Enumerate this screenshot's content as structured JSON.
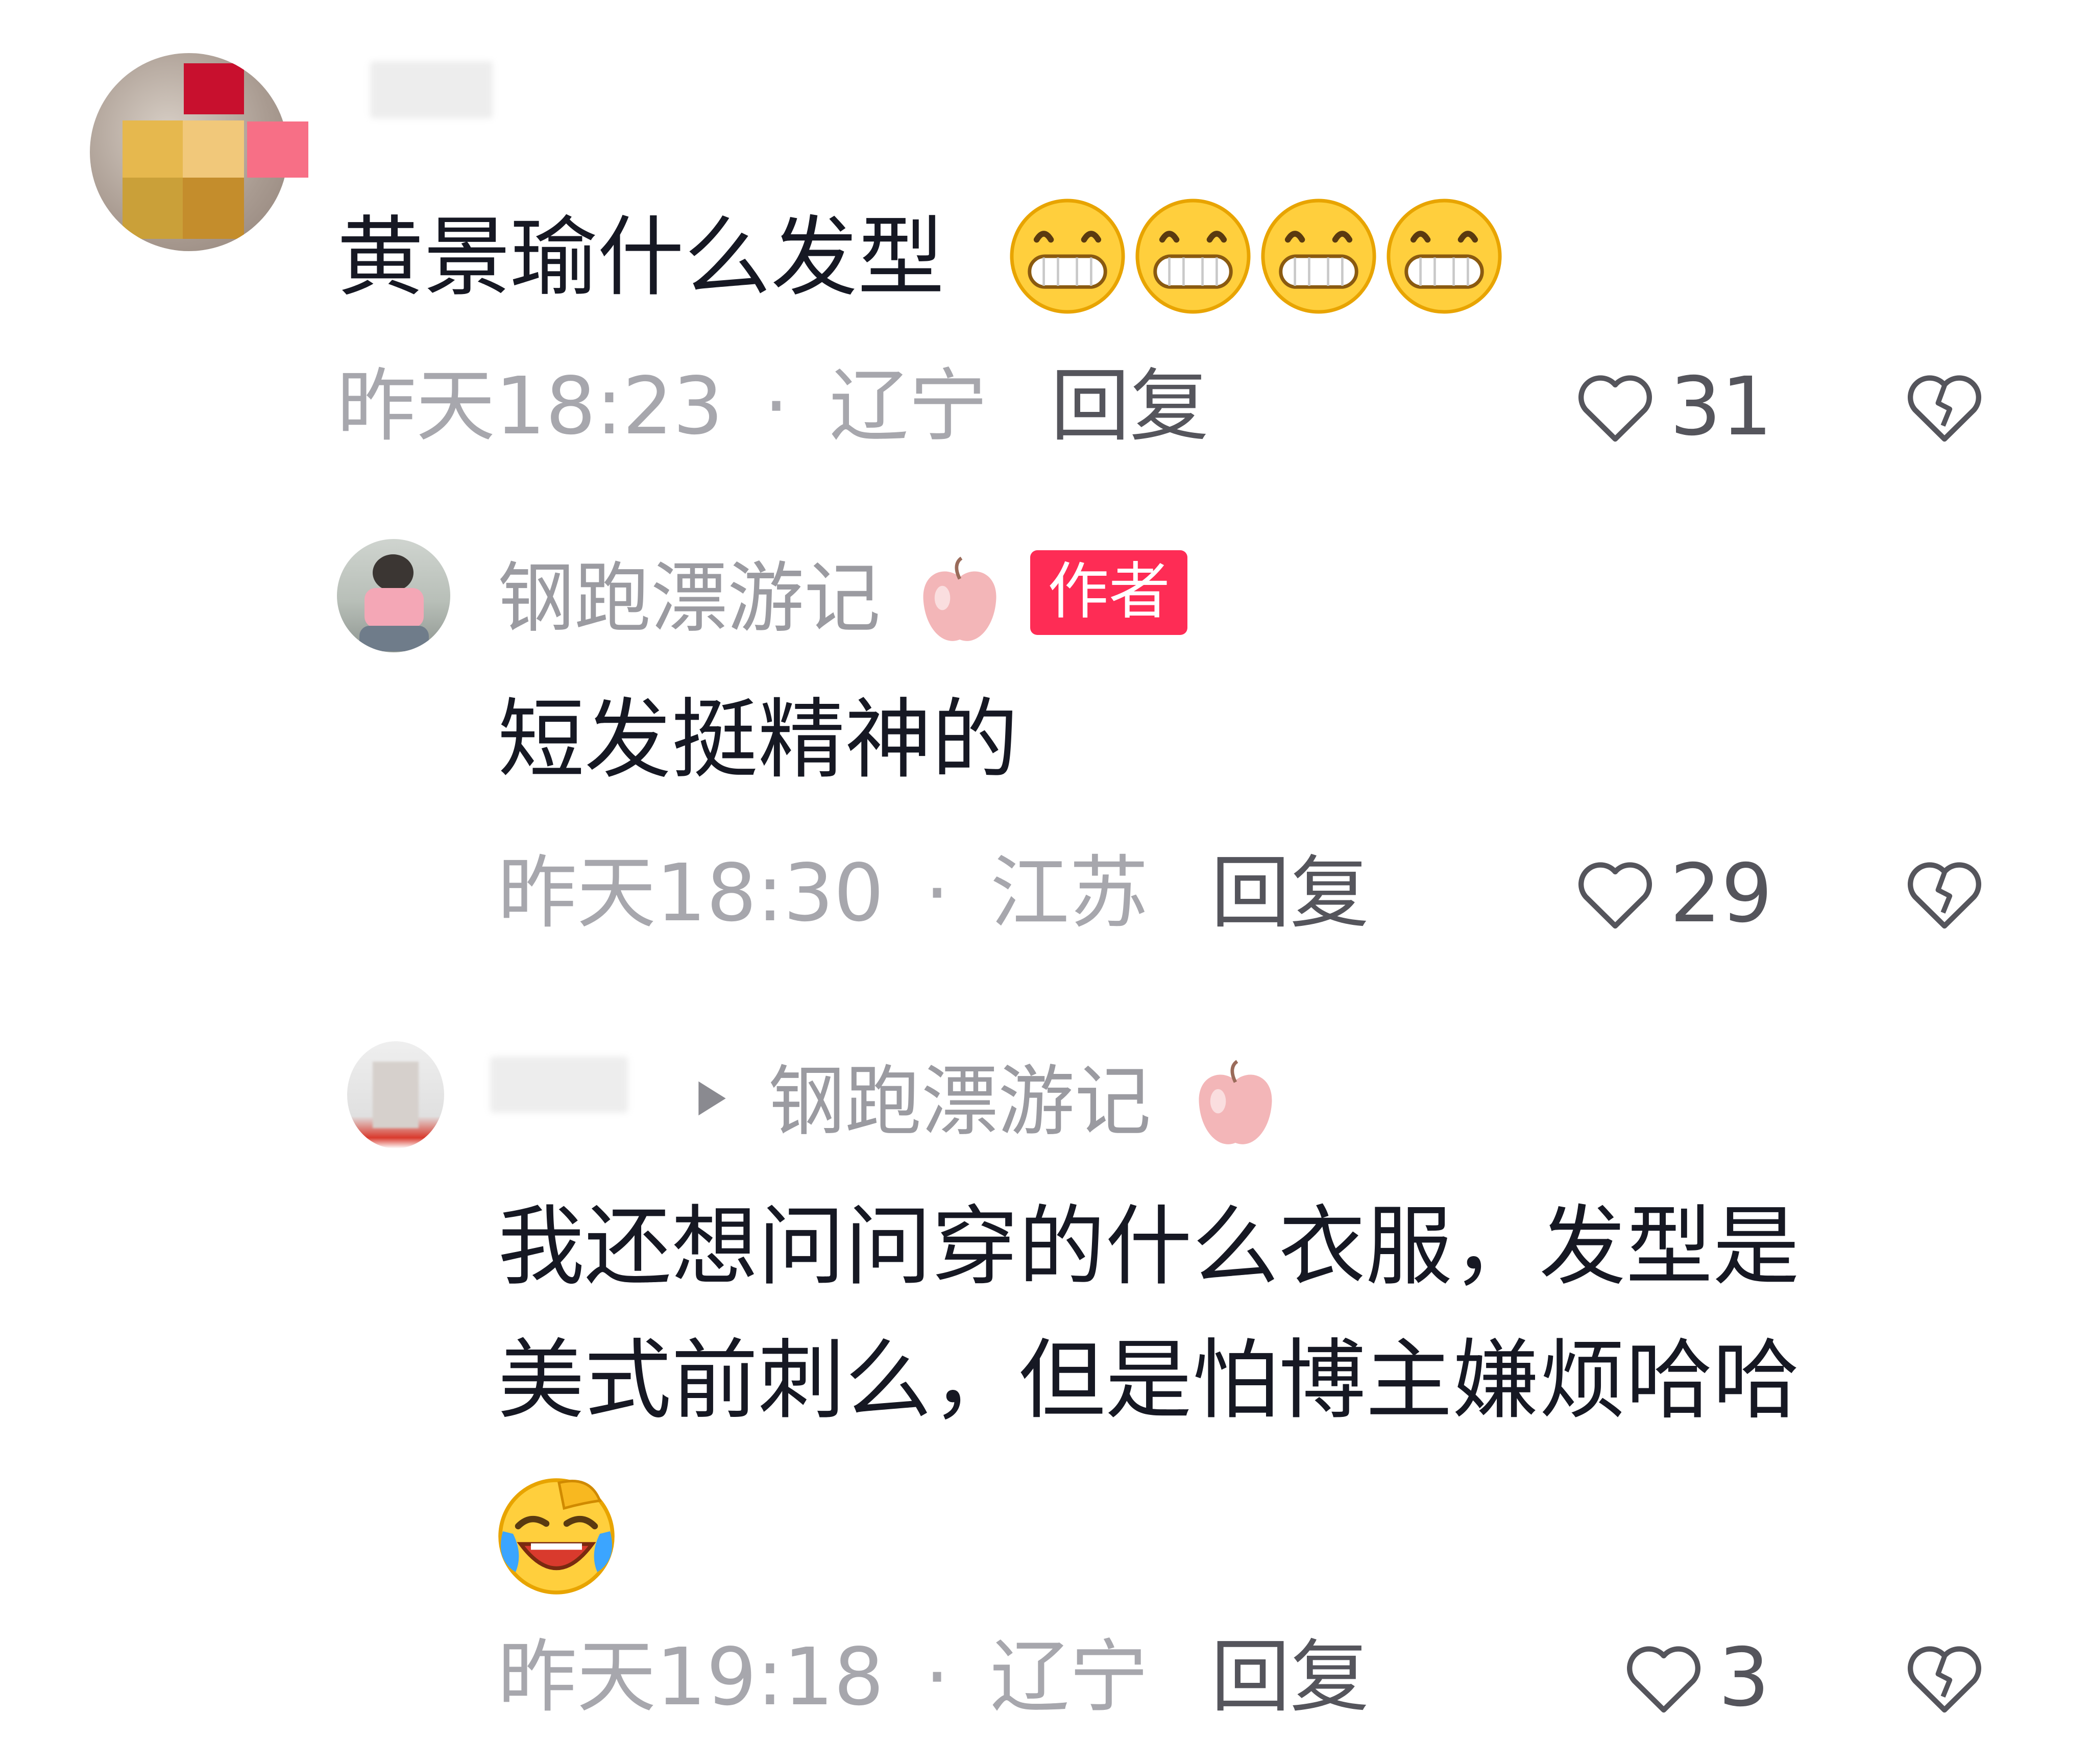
{
  "comments": [
    {
      "text": "黄景瑜什么发型",
      "emoji": [
        "grin-icon",
        "grin-icon",
        "grin-icon",
        "grin-icon"
      ],
      "time": "昨天18:23",
      "separator": "·",
      "location": "辽宁",
      "reply_label": "回复",
      "likes": "31"
    }
  ],
  "replies": [
    {
      "username": "钢跑漂游记",
      "badge": "作者",
      "text": "短发挺精神的",
      "time": "昨天18:30",
      "separator": "·",
      "location": "江苏",
      "reply_label": "回复",
      "likes": "29"
    },
    {
      "reply_to": "钢跑漂游记",
      "text_line1": "我还想问问穿的什么衣服，发型是",
      "text_line2": "美式前刺么，但是怕博主嫌烦哈哈",
      "emoji": "laugh-cry-icon",
      "time": "昨天19:18",
      "separator": "·",
      "location": "辽宁",
      "reply_label": "回复",
      "likes": "3"
    }
  ],
  "colors": {
    "badge": "#fe2c55",
    "meta": "#a7a7ad",
    "text": "#161823"
  }
}
